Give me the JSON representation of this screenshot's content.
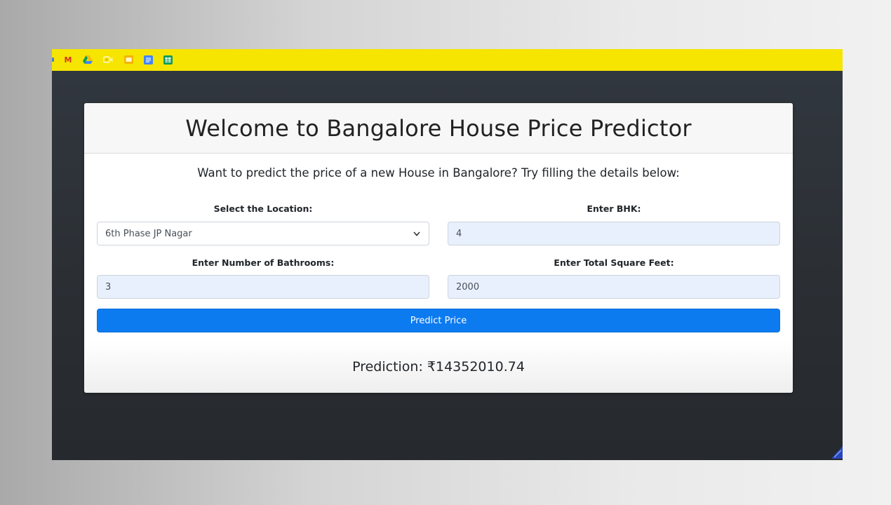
{
  "bookmarks": {
    "icons": [
      "gmail-icon",
      "google-drive-icon",
      "google-meet-icon",
      "google-slides-icon",
      "google-docs-icon",
      "google-sheets-icon"
    ],
    "gmail_glyph": "M",
    "bar_color": "#f5e500"
  },
  "header": {
    "title": "Welcome to Bangalore House Price Predictor"
  },
  "form": {
    "intro": "Want to predict the price of a new House in Bangalore? Try filling the details below:",
    "location": {
      "label": "Select the Location:",
      "selected": "6th Phase JP Nagar"
    },
    "bhk": {
      "label": "Enter BHK:",
      "value": "4"
    },
    "bathrooms": {
      "label": "Enter Number of Bathrooms:",
      "value": "3"
    },
    "sqft": {
      "label": "Enter Total Square Feet:",
      "value": "2000"
    },
    "submit_label": "Predict Price"
  },
  "result": {
    "text": "Prediction: ₹14352010.74"
  },
  "colors": {
    "button": "#0d7bf0",
    "input_fill": "#e8f0fe",
    "page_background": "#2b2f34"
  }
}
